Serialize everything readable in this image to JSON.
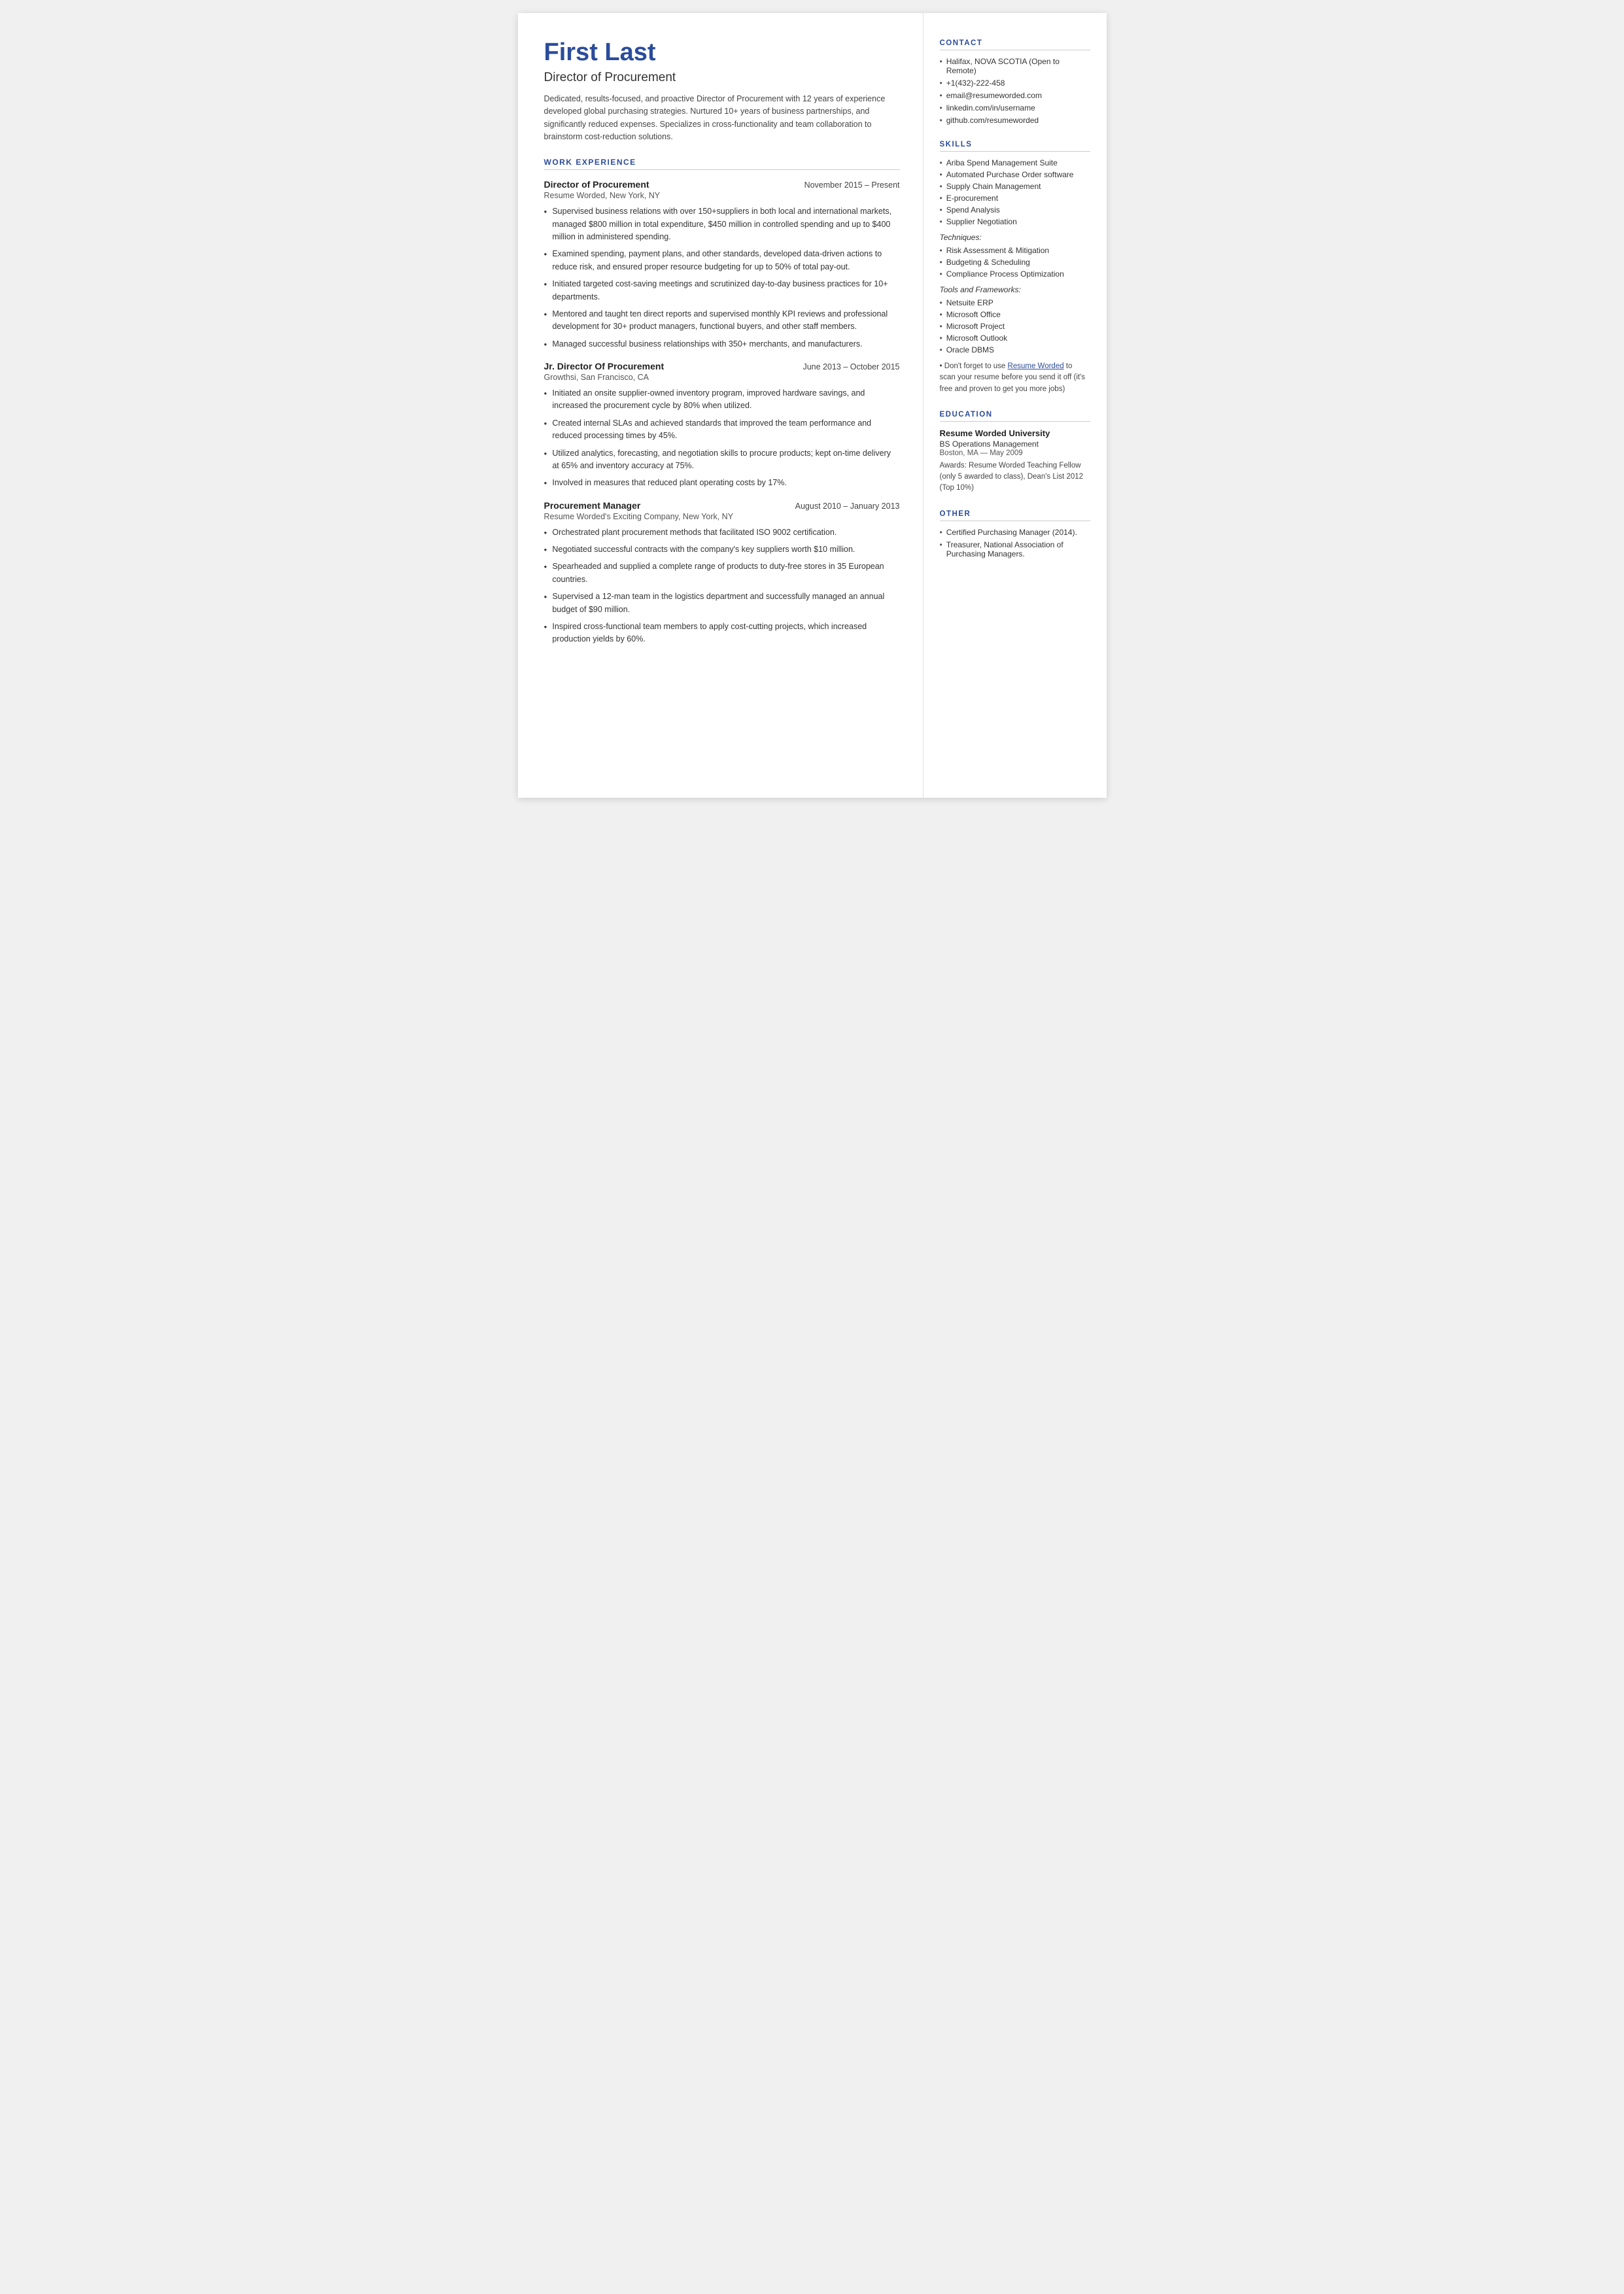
{
  "header": {
    "name": "First Last",
    "title": "Director of Procurement",
    "summary": "Dedicated, results-focused, and proactive Director of Procurement with 12 years of experience developed global purchasing strategies. Nurtured 10+ years of business partnerships, and significantly reduced expenses. Specializes in cross-functionality and team collaboration to brainstorm cost-reduction solutions."
  },
  "sections": {
    "work_experience_label": "WORK EXPERIENCE",
    "jobs": [
      {
        "title": "Director of Procurement",
        "dates": "November 2015 – Present",
        "company": "Resume Worded, New York, NY",
        "bullets": [
          "Supervised business relations with over 150+suppliers in both local and international markets, managed $800 million in total expenditure, $450 million in controlled spending and up to $400 million in administered spending.",
          "Examined spending, payment plans, and other standards, developed data-driven actions to reduce risk, and ensured proper resource budgeting for up to 50% of total pay-out.",
          "Initiated targeted cost-saving meetings and scrutinized day-to-day business practices for 10+ departments.",
          "Mentored and taught ten direct reports and supervised monthly KPI reviews and professional development for 30+ product managers, functional buyers, and other staff members.",
          "Managed successful business relationships with 350+ merchants, and manufacturers."
        ]
      },
      {
        "title": "Jr. Director Of Procurement",
        "dates": "June 2013 – October 2015",
        "company": "Growthsi, San Francisco, CA",
        "bullets": [
          "Initiated an onsite supplier-owned inventory program, improved hardware savings, and increased the procurement cycle by 80% when utilized.",
          "Created internal SLAs and achieved standards that improved the team performance and reduced processing times by 45%.",
          "Utilized analytics, forecasting, and negotiation skills to procure products; kept on-time delivery at 65% and inventory accuracy at 75%.",
          "Involved in measures that reduced plant operating costs by 17%."
        ]
      },
      {
        "title": "Procurement Manager",
        "dates": "August 2010 – January 2013",
        "company": "Resume Worded's Exciting Company, New York, NY",
        "bullets": [
          "Orchestrated plant procurement methods that facilitated ISO 9002 certification.",
          "Negotiated successful contracts with the company's key suppliers worth $10 million.",
          "Spearheaded and supplied a complete range of products to duty-free stores in 35 European countries.",
          "Supervised a 12-man team in the logistics department and successfully managed an annual budget of $90 million.",
          "Inspired cross-functional team members to apply cost-cutting projects, which increased production yields by 60%."
        ]
      }
    ]
  },
  "sidebar": {
    "contact_label": "CONTACT",
    "contact_items": [
      "Halifax, NOVA SCOTIA (Open to Remote)",
      "+1(432)-222-458",
      "email@resumeworded.com",
      "linkedin.com/in/username",
      "github.com/resumeworded"
    ],
    "skills_label": "SKILLS",
    "skills_main": [
      "Ariba Spend Management Suite",
      "Automated Purchase Order software",
      "Supply Chain Management",
      "E-procurement",
      "Spend Analysis",
      "Supplier Negotiation"
    ],
    "techniques_label": "Techniques:",
    "techniques": [
      "Risk Assessment & Mitigation",
      "Budgeting & Scheduling",
      "Compliance Process Optimization"
    ],
    "tools_label": "Tools and Frameworks:",
    "tools": [
      "Netsuite ERP",
      "Microsoft Office",
      "Microsoft Project",
      "Microsoft Outlook",
      "Oracle DBMS"
    ],
    "resume_worded_note": "Don't forget to use Resume Worded to scan your resume before you send it off (it's free and proven to get you more jobs)",
    "resume_worded_link_text": "Resume Worded",
    "education_label": "EDUCATION",
    "education": {
      "school": "Resume Worded University",
      "degree": "BS Operations Management",
      "date": "Boston, MA — May 2009",
      "awards": "Awards: Resume Worded Teaching Fellow (only 5 awarded to class), Dean's List 2012 (Top 10%)"
    },
    "other_label": "OTHER",
    "other_items": [
      "Certified Purchasing Manager (2014).",
      "Treasurer, National Association of Purchasing Managers."
    ]
  }
}
